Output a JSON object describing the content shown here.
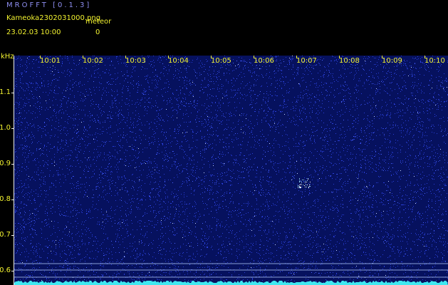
{
  "header": {
    "app_title": "MROFFT [0.1.3]",
    "filename": "Kameoka2302031000.png",
    "meteor_label": "meteor",
    "datetime": "23.02.03  10:00",
    "meteor_count": "0"
  },
  "axes": {
    "y_unit": "kHz",
    "y_ticks": [
      "1.1",
      "1.0",
      "0.9",
      "0.8",
      "0.7",
      "0.6"
    ],
    "x_ticks": [
      "10:01",
      "10:02",
      "10:03",
      "10:04",
      "10:05",
      "10:06",
      "10:07",
      "10:08",
      "10:09",
      "10:10"
    ]
  },
  "colors": {
    "background": "#000000",
    "spectrogram_bg": "#06115e",
    "noise": "#2a3fd8",
    "label_yellow": "#f2f230",
    "title_blue": "#8e8ef0",
    "signal_cyan": "#3fe8f0"
  }
}
